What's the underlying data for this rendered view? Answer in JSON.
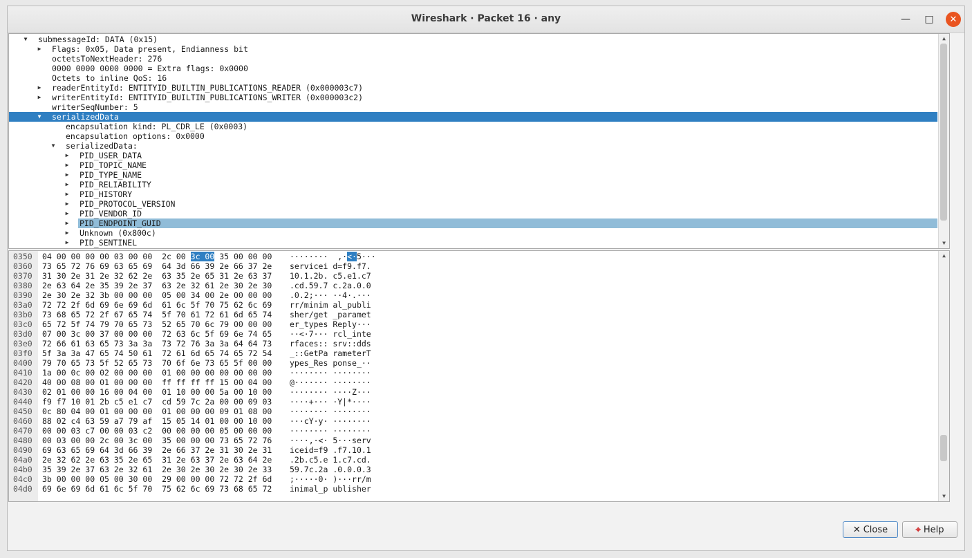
{
  "window": {
    "title": "Wireshark · Packet 16 · any"
  },
  "icons": {
    "minimize": "minimize-icon",
    "maximize": "maximize-icon",
    "close": "close-icon",
    "expanded": "triangle-down-icon",
    "collapsed": "triangle-right-icon"
  },
  "colors": {
    "selection": "#2f7fc2",
    "highlight": "#90bcd8",
    "close_button": "#e95420"
  },
  "tree": {
    "rows": [
      {
        "text": "submessageId: DATA (0x15)",
        "indent": 0,
        "state": "expanded"
      },
      {
        "text": "Flags: 0x05, Data present, Endianness bit",
        "indent": 1,
        "state": "collapsed"
      },
      {
        "text": "octetsToNextHeader: 276",
        "indent": 1,
        "state": "none"
      },
      {
        "text": "0000 0000 0000 0000 = Extra flags: 0x0000",
        "indent": 1,
        "state": "none"
      },
      {
        "text": "Octets to inline QoS: 16",
        "indent": 1,
        "state": "none"
      },
      {
        "text": "readerEntityId: ENTITYID_BUILTIN_PUBLICATIONS_READER (0x000003c7)",
        "indent": 1,
        "state": "collapsed"
      },
      {
        "text": "writerEntityId: ENTITYID_BUILTIN_PUBLICATIONS_WRITER (0x000003c2)",
        "indent": 1,
        "state": "collapsed"
      },
      {
        "text": "writerSeqNumber: 5",
        "indent": 1,
        "state": "none"
      },
      {
        "text": "serializedData",
        "indent": 1,
        "state": "expanded",
        "selected": true
      },
      {
        "text": "encapsulation kind: PL_CDR_LE (0x0003)",
        "indent": 2,
        "state": "none"
      },
      {
        "text": "encapsulation options: 0x0000",
        "indent": 2,
        "state": "none"
      },
      {
        "text": "serializedData:",
        "indent": 2,
        "state": "expanded"
      },
      {
        "text": "PID_USER_DATA",
        "indent": 3,
        "state": "collapsed"
      },
      {
        "text": "PID_TOPIC_NAME",
        "indent": 3,
        "state": "collapsed"
      },
      {
        "text": "PID_TYPE_NAME",
        "indent": 3,
        "state": "collapsed"
      },
      {
        "text": "PID_RELIABILITY",
        "indent": 3,
        "state": "collapsed"
      },
      {
        "text": "PID_HISTORY",
        "indent": 3,
        "state": "collapsed"
      },
      {
        "text": "PID_PROTOCOL_VERSION",
        "indent": 3,
        "state": "collapsed"
      },
      {
        "text": "PID_VENDOR_ID",
        "indent": 3,
        "state": "collapsed"
      },
      {
        "text": "PID_ENDPOINT_GUID",
        "indent": 3,
        "state": "collapsed",
        "highlighted": true
      },
      {
        "text": "Unknown (0x800c)",
        "indent": 3,
        "state": "collapsed"
      },
      {
        "text": "PID_SENTINEL",
        "indent": 3,
        "state": "collapsed"
      }
    ]
  },
  "hex": {
    "rows": [
      {
        "offset": "0350",
        "h1": "04 00 00 00 00 03 00 00",
        "h2a": "2c 00 ",
        "h2sel": "3c 00",
        "h2b": " 35 00 00 00",
        "a1": "········",
        "a2a": " ,·",
        "a2sel": "<·",
        "a2b": "5···"
      },
      {
        "offset": "0360",
        "h1": "73 65 72 76 69 63 65 69",
        "h2": "64 3d 66 39 2e 66 37 2e",
        "a1": "servicei",
        "a2": "d=f9.f7."
      },
      {
        "offset": "0370",
        "h1": "31 30 2e 31 2e 32 62 2e",
        "h2": "63 35 2e 65 31 2e 63 37",
        "a1": "10.1.2b.",
        "a2": "c5.e1.c7"
      },
      {
        "offset": "0380",
        "h1": "2e 63 64 2e 35 39 2e 37",
        "h2": "63 2e 32 61 2e 30 2e 30",
        "a1": ".cd.59.7",
        "a2": "c.2a.0.0"
      },
      {
        "offset": "0390",
        "h1": "2e 30 2e 32 3b 00 00 00",
        "h2": "05 00 34 00 2e 00 00 00",
        "a1": ".0.2;···",
        "a2": "··4·.···"
      },
      {
        "offset": "03a0",
        "h1": "72 72 2f 6d 69 6e 69 6d",
        "h2": "61 6c 5f 70 75 62 6c 69",
        "a1": "rr/minim",
        "a2": "al_publi"
      },
      {
        "offset": "03b0",
        "h1": "73 68 65 72 2f 67 65 74",
        "h2": "5f 70 61 72 61 6d 65 74",
        "a1": "sher/get",
        "a2": "_paramet"
      },
      {
        "offset": "03c0",
        "h1": "65 72 5f 74 79 70 65 73",
        "h2": "52 65 70 6c 79 00 00 00",
        "a1": "er_types",
        "a2": "Reply···"
      },
      {
        "offset": "03d0",
        "h1": "07 00 3c 00 37 00 00 00",
        "h2": "72 63 6c 5f 69 6e 74 65",
        "a1": "··<·7···",
        "a2": "rcl_inte"
      },
      {
        "offset": "03e0",
        "h1": "72 66 61 63 65 73 3a 3a",
        "h2": "73 72 76 3a 3a 64 64 73",
        "a1": "rfaces::",
        "a2": "srv::dds"
      },
      {
        "offset": "03f0",
        "h1": "5f 3a 3a 47 65 74 50 61",
        "h2": "72 61 6d 65 74 65 72 54",
        "a1": "_::GetPa",
        "a2": "rameterT"
      },
      {
        "offset": "0400",
        "h1": "79 70 65 73 5f 52 65 73",
        "h2": "70 6f 6e 73 65 5f 00 00",
        "a1": "ypes_Res",
        "a2": "ponse_··"
      },
      {
        "offset": "0410",
        "h1": "1a 00 0c 00 02 00 00 00",
        "h2": "01 00 00 00 00 00 00 00",
        "a1": "········",
        "a2": "········"
      },
      {
        "offset": "0420",
        "h1": "40 00 08 00 01 00 00 00",
        "h2": "ff ff ff ff 15 00 04 00",
        "a1": "@·······",
        "a2": "········"
      },
      {
        "offset": "0430",
        "h1": "02 01 00 00 16 00 04 00",
        "h2": "01 10 00 00 5a 00 10 00",
        "a1": "········",
        "a2": "····Z···"
      },
      {
        "offset": "0440",
        "h1": "f9 f7 10 01 2b c5 e1 c7",
        "h2": "cd 59 7c 2a 00 00 09 03",
        "a1": "····+···",
        "a2": "·Y|*····"
      },
      {
        "offset": "0450",
        "h1": "0c 80 04 00 01 00 00 00",
        "h2": "01 00 00 00 09 01 08 00",
        "a1": "········",
        "a2": "········"
      },
      {
        "offset": "0460",
        "h1": "88 02 c4 63 59 a7 79 af",
        "h2": "15 05 14 01 00 00 10 00",
        "a1": "···cY·y·",
        "a2": "········"
      },
      {
        "offset": "0470",
        "h1": "00 00 03 c7 00 00 03 c2",
        "h2": "00 00 00 00 05 00 00 00",
        "a1": "········",
        "a2": "········"
      },
      {
        "offset": "0480",
        "h1": "00 03 00 00 2c 00 3c 00",
        "h2": "35 00 00 00 73 65 72 76",
        "a1": "····,·<·",
        "a2": "5···serv"
      },
      {
        "offset": "0490",
        "h1": "69 63 65 69 64 3d 66 39",
        "h2": "2e 66 37 2e 31 30 2e 31",
        "a1": "iceid=f9",
        "a2": ".f7.10.1"
      },
      {
        "offset": "04a0",
        "h1": "2e 32 62 2e 63 35 2e 65",
        "h2": "31 2e 63 37 2e 63 64 2e",
        "a1": ".2b.c5.e",
        "a2": "1.c7.cd."
      },
      {
        "offset": "04b0",
        "h1": "35 39 2e 37 63 2e 32 61",
        "h2": "2e 30 2e 30 2e 30 2e 33",
        "a1": "59.7c.2a",
        "a2": ".0.0.0.3"
      },
      {
        "offset": "04c0",
        "h1": "3b 00 00 00 05 00 30 00",
        "h2": "29 00 00 00 72 72 2f 6d",
        "a1": ";·····0·",
        "a2": ")···rr/m"
      },
      {
        "offset": "04d0",
        "h1": "69 6e 69 6d 61 6c 5f 70",
        "h2": "75 62 6c 69 73 68 65 72",
        "a1": "inimal_p",
        "a2": "ublisher"
      }
    ]
  },
  "buttons": {
    "close_label": "Close",
    "help_label": "Help"
  }
}
